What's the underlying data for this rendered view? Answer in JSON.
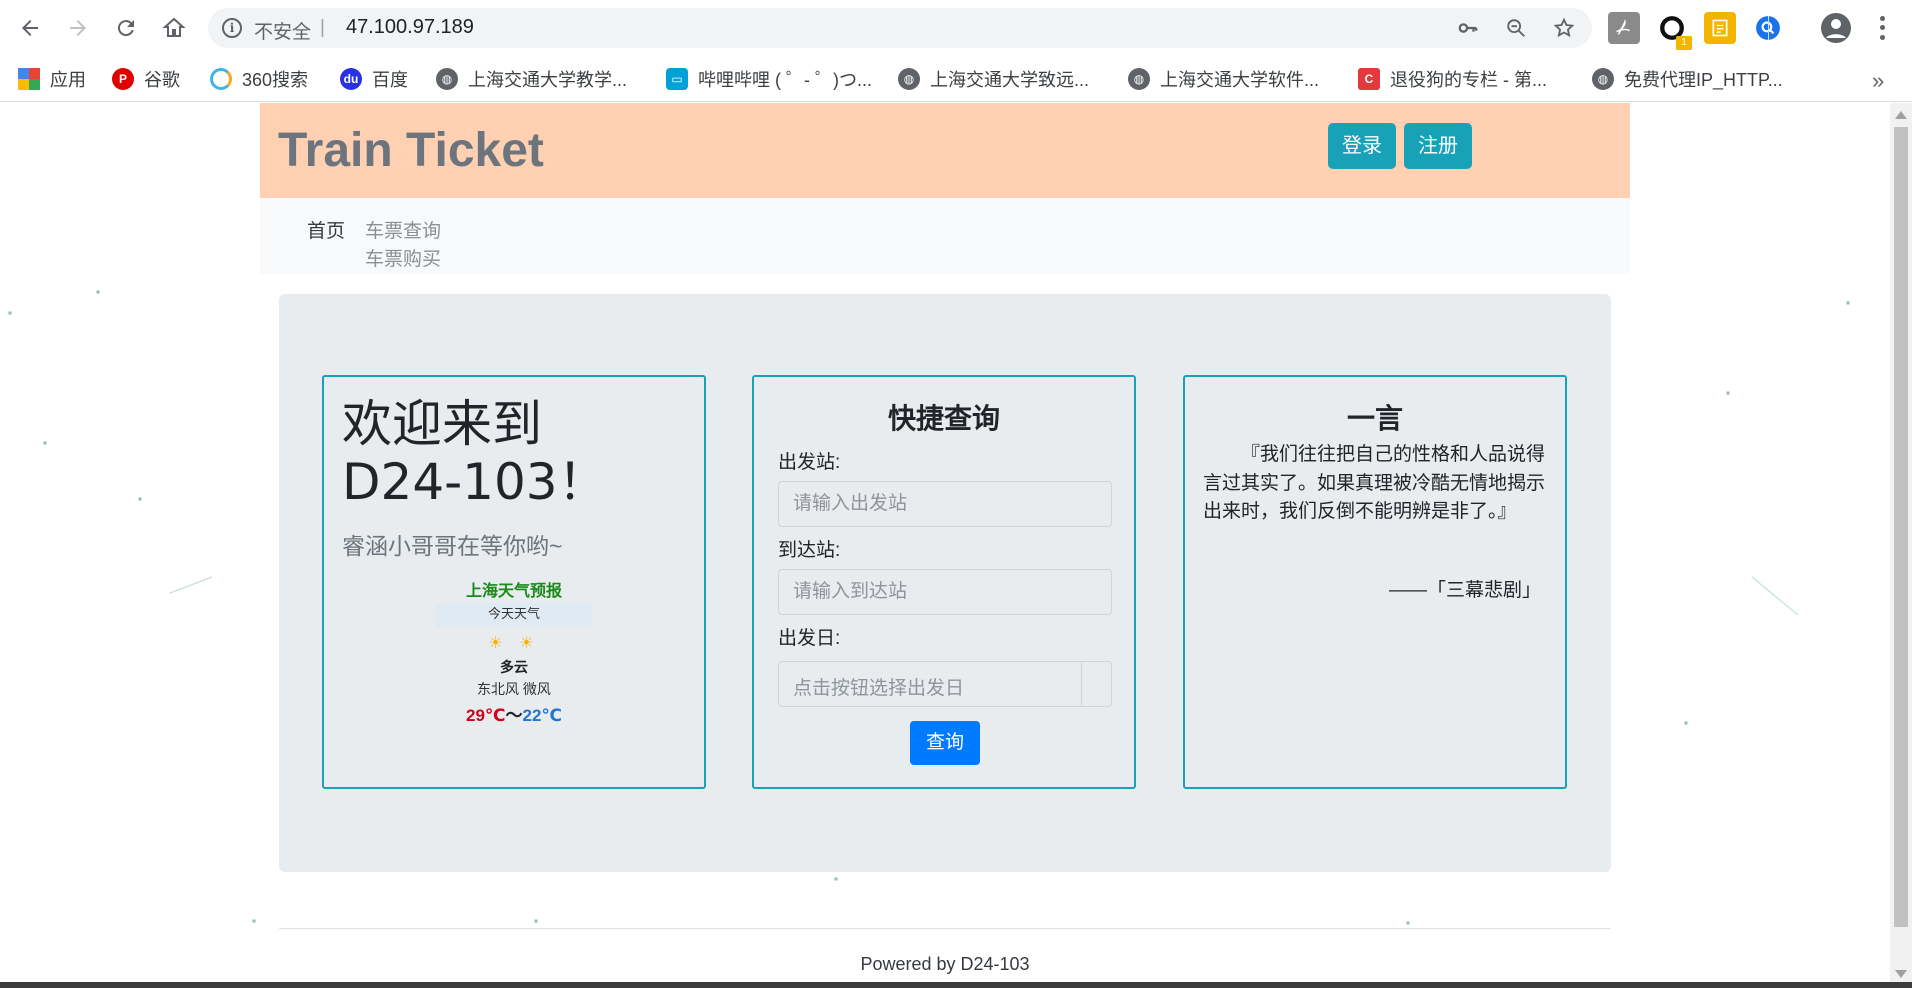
{
  "browser": {
    "security_label": "不安全",
    "separator": "|",
    "url": "47.100.97.189",
    "extension_badge": "1",
    "bookmarks": [
      {
        "label": "应用",
        "icon": "apps-grid-icon",
        "color": "#e94235"
      },
      {
        "label": "谷歌",
        "icon": "google-p-icon",
        "color": "#e00000"
      },
      {
        "label": "360搜索",
        "icon": "search-360-icon",
        "color": "#f5a623"
      },
      {
        "label": "百度",
        "icon": "baidu-paw-icon",
        "color": "#2932e1"
      },
      {
        "label": "上海交通大学教学...",
        "icon": "globe-icon",
        "color": "#5f6368"
      },
      {
        "label": "哔哩哔哩 ( ゜- ゜)つ...",
        "icon": "bilibili-icon",
        "color": "#00a1d6"
      },
      {
        "label": "上海交通大学致远...",
        "icon": "globe-icon",
        "color": "#5f6368"
      },
      {
        "label": "上海交通大学软件...",
        "icon": "globe-icon",
        "color": "#5f6368"
      },
      {
        "label": "退役狗的专栏 - 第...",
        "icon": "csdn-c-icon",
        "color": "#e4393c"
      },
      {
        "label": "免费代理IP_HTTP...",
        "icon": "globe-icon",
        "color": "#5f6368"
      }
    ],
    "more_bookmarks": "»"
  },
  "header": {
    "brand": "Train Ticket",
    "login_label": "登录",
    "register_label": "注册"
  },
  "nav": {
    "home": "首页",
    "ticket_search": "车票查询",
    "ticket_buy": "车票购买"
  },
  "welcome": {
    "title_line1": "欢迎来到",
    "title_line2": "D24-103！",
    "subtitle": "睿涵小哥哥在等你哟~"
  },
  "weather": {
    "city": "上海天气预报",
    "today_label": "今天天气",
    "icons": "☀ ☀",
    "condition": "多云",
    "wind": "东北风 微风",
    "temp_high": "29℃",
    "temp_sep": "～",
    "temp_low": "22℃"
  },
  "quick_search": {
    "title": "快捷查询",
    "from_label": "出发站:",
    "from_placeholder": "请输入出发站",
    "to_label": "到达站:",
    "to_placeholder": "请输入到达站",
    "date_label": "出发日:",
    "date_placeholder": "点击按钮选择出发日",
    "submit_label": "查询"
  },
  "quote": {
    "title": "一言",
    "text": "『我们往往把自己的性格和人品说得言过其实了。如果真理被冷酷无情地揭示出来时，我们反倒不能明辨是非了。』",
    "source": "——「三幕悲剧」"
  },
  "footer": {
    "text": "Powered by D24-103"
  },
  "colors": {
    "header_bg": "#ffd0b2",
    "info_button": "#17a2b8",
    "primary_button": "#007bff",
    "card_border": "#17a2b8",
    "jumbotron_bg": "#e9ecef"
  }
}
